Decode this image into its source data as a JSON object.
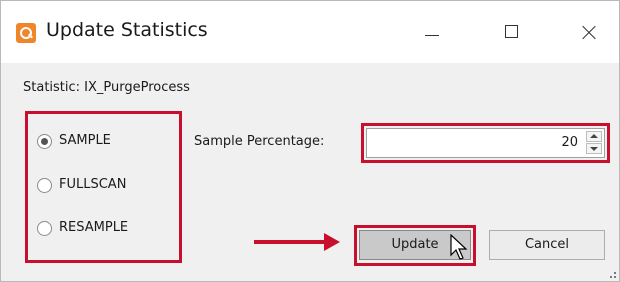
{
  "window": {
    "title": "Update Statistics",
    "app_icon": "app-logo-icon",
    "controls": [
      "minimize-icon",
      "maximize-icon",
      "close-icon"
    ]
  },
  "statistic": {
    "label": "Statistic: IX_PurgeProcess"
  },
  "scan_options": [
    {
      "label": "SAMPLE",
      "selected": true
    },
    {
      "label": "FULLSCAN",
      "selected": false
    },
    {
      "label": "RESAMPLE",
      "selected": false
    }
  ],
  "sample_percentage": {
    "label": "Sample Percentage:",
    "value": "20"
  },
  "buttons": {
    "update_label": "Update",
    "cancel_label": "Cancel"
  },
  "colors": {
    "highlight": "#c8102e",
    "app_icon": "#f0862a",
    "titlebar": "#ffffff",
    "dialog_bg": "#f0f0f0"
  }
}
